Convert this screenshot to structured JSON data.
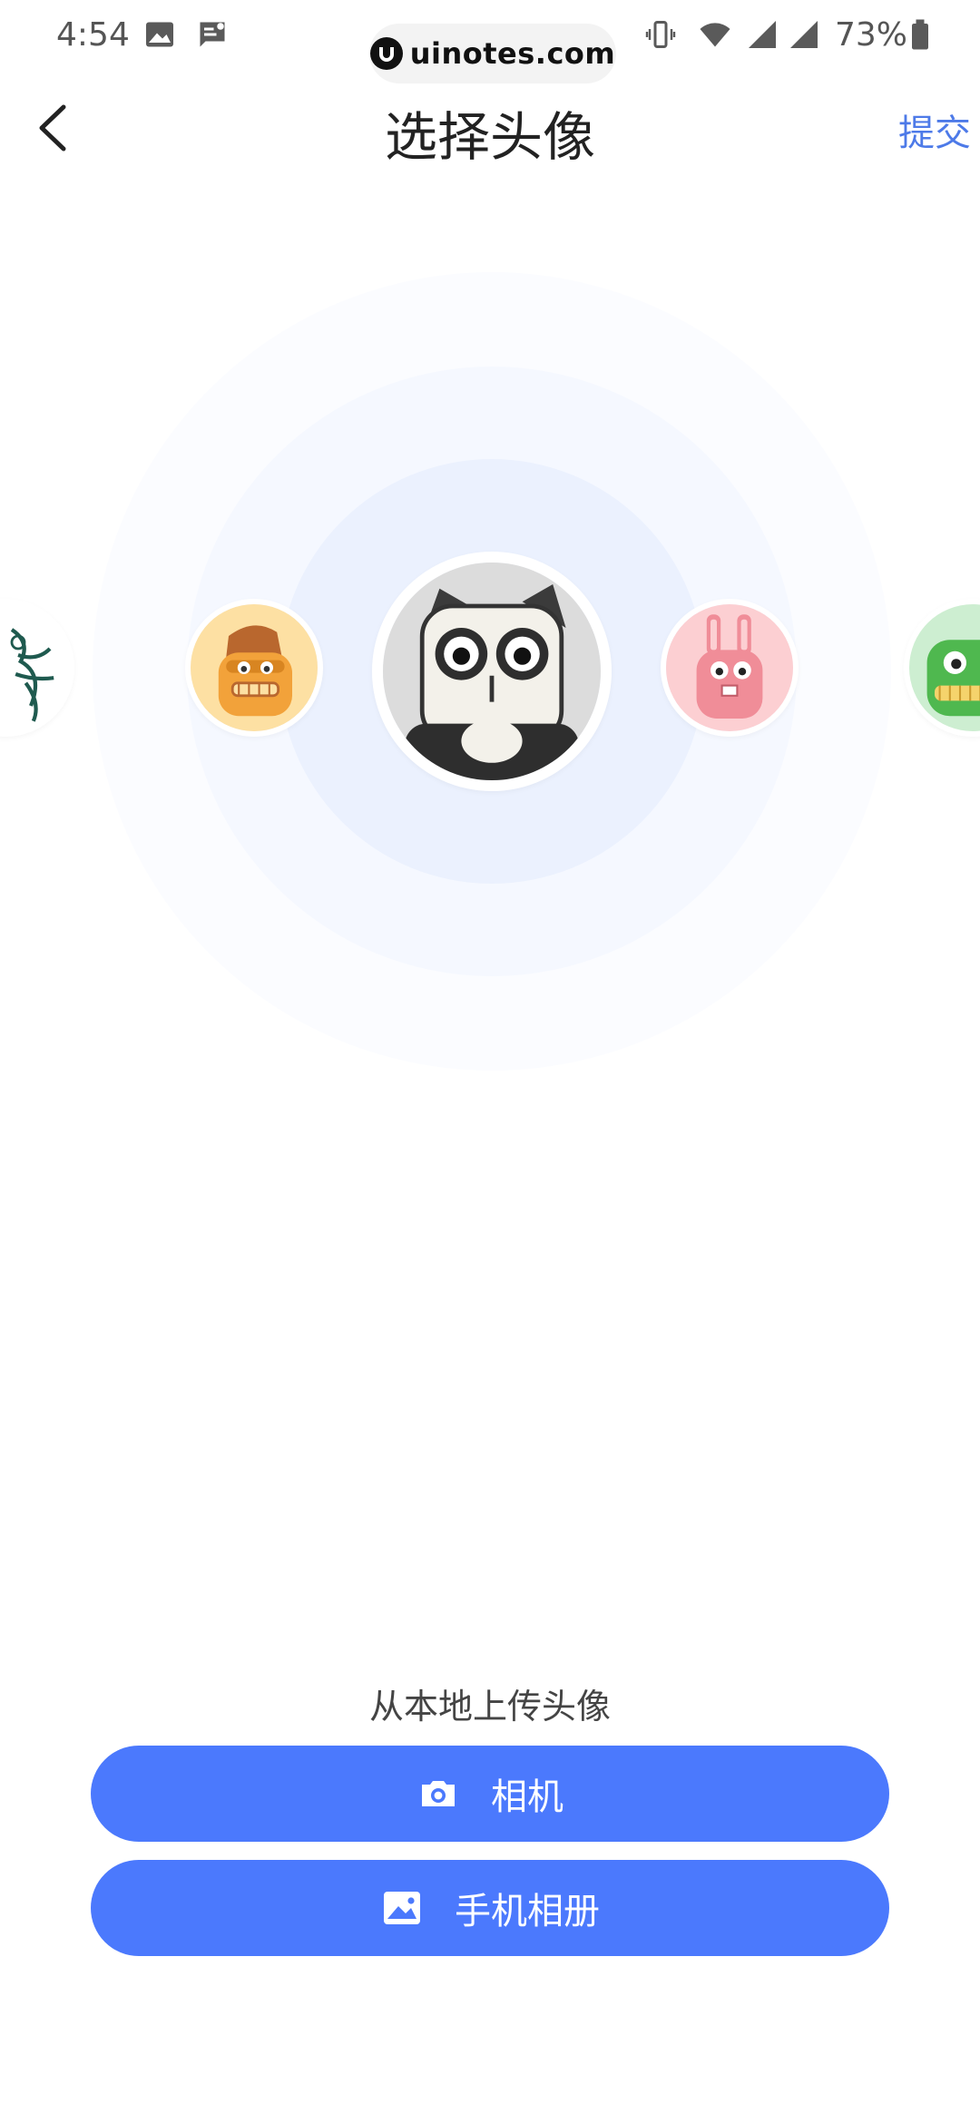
{
  "status_bar": {
    "time": "4:54",
    "watermark": "uinotes.com",
    "battery": "73%",
    "icons": [
      "image-icon",
      "message-icon",
      "vibrate-icon",
      "wifi-icon",
      "signal-icon",
      "signal-icon",
      "battery-icon"
    ]
  },
  "header": {
    "back_icon": "chevron-left-icon",
    "title": "选择头像",
    "submit": "提交"
  },
  "avatars": {
    "selected": "panda",
    "items": [
      "sketch",
      "orange-monster",
      "panda",
      "pink-rabbit",
      "green-monster"
    ]
  },
  "upload": {
    "hint": "从本地上传头像",
    "camera_label": "相机",
    "camera_icon": "camera-icon",
    "album_label": "手机相册",
    "album_icon": "image-icon"
  },
  "colors": {
    "accent": "#4b79fd",
    "link": "#4d7ae8",
    "ring_inner": "#ebf1fe"
  }
}
